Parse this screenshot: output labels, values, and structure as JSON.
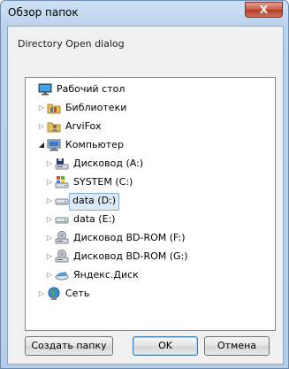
{
  "window": {
    "title": "Обзор папок",
    "close_label": "X"
  },
  "description": "Directory Open dialog",
  "tree": [
    {
      "label": "Рабочий стол",
      "icon": "desktop-icon"
    },
    {
      "label": "Библиотеки",
      "icon": "libraries-icon"
    },
    {
      "label": "ArviFox",
      "icon": "user-folder-icon"
    },
    {
      "label": "Компьютер",
      "icon": "computer-icon"
    },
    {
      "label": "Дисковод (A:)",
      "icon": "floppy-drive-icon"
    },
    {
      "label": "SYSTEM (C:)",
      "icon": "system-drive-icon"
    },
    {
      "label": "data (D:)",
      "icon": "hard-drive-icon",
      "selected": true
    },
    {
      "label": "data (E:)",
      "icon": "hard-drive-icon"
    },
    {
      "label": "Дисковод BD-ROM (F:)",
      "icon": "optical-drive-icon"
    },
    {
      "label": "Дисковод BD-ROM (G:)",
      "icon": "optical-drive-icon"
    },
    {
      "label": "Яндекс.Диск",
      "icon": "cloud-drive-icon"
    },
    {
      "label": "Сеть",
      "icon": "network-icon"
    }
  ],
  "buttons": {
    "new_folder": "Создать папку",
    "ok": "OK",
    "cancel": "Отмена"
  }
}
